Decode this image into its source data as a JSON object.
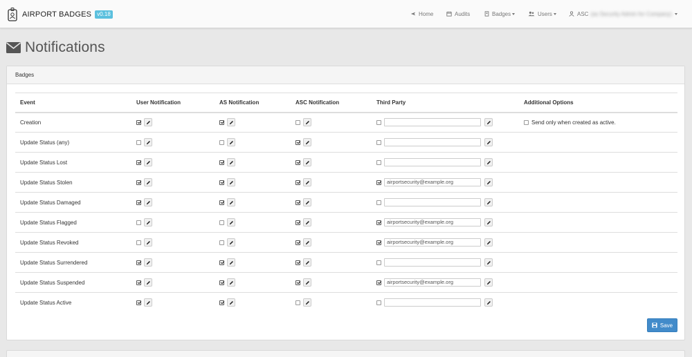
{
  "brand": {
    "name": "AIRPORT BADGES",
    "version": "v0.18"
  },
  "nav": {
    "home": "Home",
    "audits": "Audits",
    "badges": "Badges",
    "users": "Users",
    "user_short": "ASC",
    "user_detail": "(as Security Admin for Company)"
  },
  "page": {
    "title": "Notifications"
  },
  "panel": {
    "title": "Badges"
  },
  "table": {
    "headers": [
      "Event",
      "User Notification",
      "AS Notification",
      "ASC Notification",
      "Third Party",
      "Additional Options"
    ],
    "rows": [
      {
        "event": "Creation",
        "user": true,
        "as": true,
        "asc": false,
        "tp": false,
        "tp_email": "",
        "option": "Send only when created as active."
      },
      {
        "event": "Update Status (any)",
        "user": false,
        "as": false,
        "asc": true,
        "tp": false,
        "tp_email": ""
      },
      {
        "event": "Update Status Lost",
        "user": true,
        "as": true,
        "asc": true,
        "tp": false,
        "tp_email": ""
      },
      {
        "event": "Update Status Stolen",
        "user": true,
        "as": true,
        "asc": true,
        "tp": true,
        "tp_email": "airportsecurity@example.org"
      },
      {
        "event": "Update Status Damaged",
        "user": true,
        "as": true,
        "asc": true,
        "tp": false,
        "tp_email": ""
      },
      {
        "event": "Update Status Flagged",
        "user": false,
        "as": false,
        "asc": true,
        "tp": true,
        "tp_email": "airportsecurity@example.org"
      },
      {
        "event": "Update Status Revoked",
        "user": false,
        "as": false,
        "asc": true,
        "tp": true,
        "tp_email": "airportsecurity@example.org"
      },
      {
        "event": "Update Status Surrendered",
        "user": true,
        "as": true,
        "asc": true,
        "tp": false,
        "tp_email": ""
      },
      {
        "event": "Update Status Suspended",
        "user": true,
        "as": true,
        "asc": true,
        "tp": true,
        "tp_email": "airportsecurity@example.org"
      },
      {
        "event": "Update Status Active",
        "user": true,
        "as": true,
        "asc": false,
        "tp": false,
        "tp_email": ""
      }
    ]
  },
  "save_label": "Save",
  "icons": [
    "badge-logo-icon",
    "plane-icon",
    "calendar-icon",
    "id-card-icon",
    "users-icon",
    "user-icon",
    "envelope-icon",
    "pencil-icon",
    "floppy-icon"
  ],
  "colors": {
    "primary": "#428bca",
    "version_badge": "#5bc0de"
  }
}
